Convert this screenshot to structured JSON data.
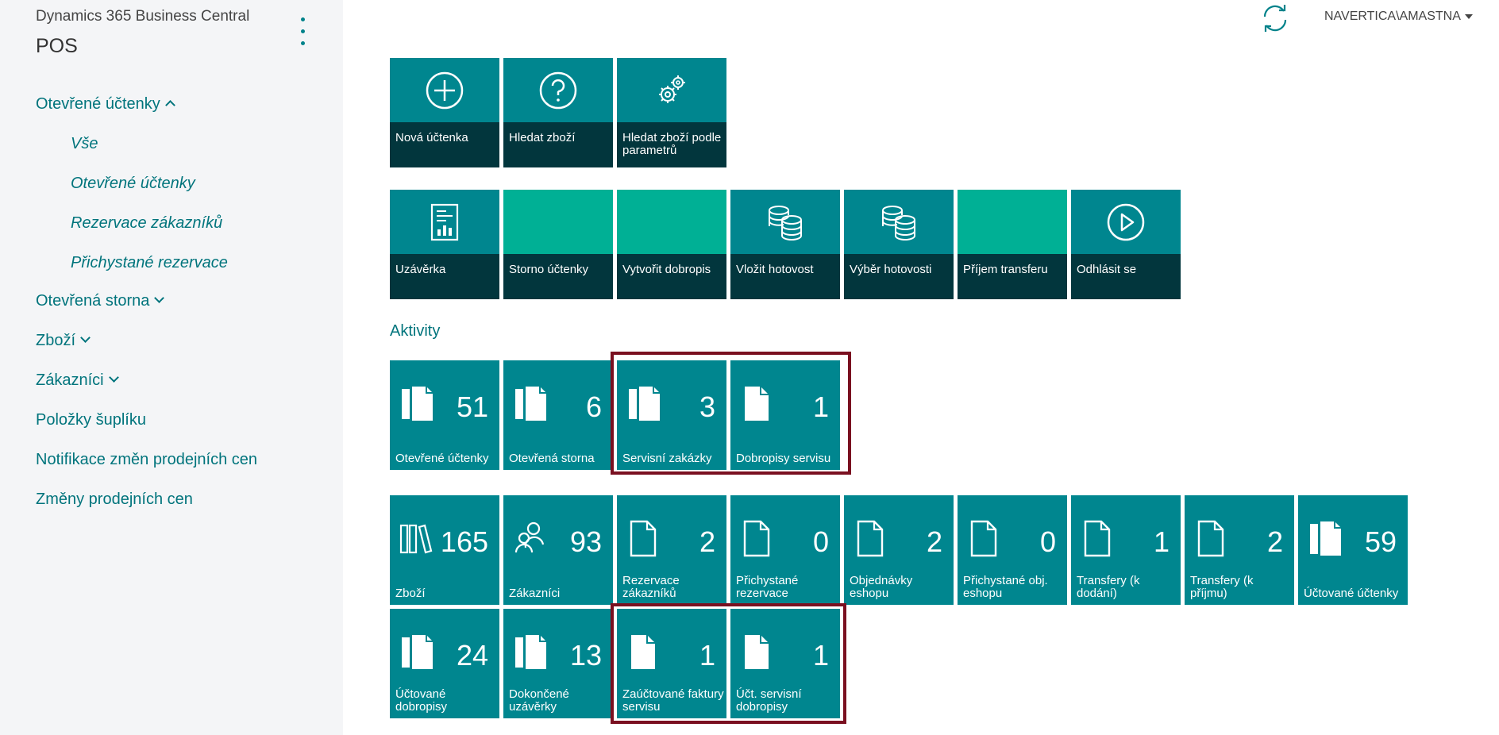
{
  "header": {
    "app_name": "Dynamics 365 Business Central",
    "role_title": "POS",
    "user": "NAVERTICA\\AMASTNA"
  },
  "nav": {
    "open_receipts": "Otevřené účtenky",
    "all": "Vše",
    "open_receipts_sub": "Otevřené účtenky",
    "customer_reservations": "Rezervace zákazníků",
    "prepared_reservations": "Přichystané rezervace",
    "open_reversals": "Otevřená storna",
    "items": "Zboží",
    "customers": "Zákazníci",
    "drawer_entries": "Položky šuplíku",
    "price_notifications": "Notifikace změn prodejních cen",
    "price_changes": "Změny prodejních cen"
  },
  "actions_row1": [
    {
      "label": "Nová účtenka",
      "icon": "plus-circle-icon"
    },
    {
      "label": "Hledat zboží",
      "icon": "question-circle-icon"
    },
    {
      "label": "Hledat zboží podle parametrů",
      "icon": "gears-icon"
    }
  ],
  "actions_row2": [
    {
      "label": "Uzávěrka",
      "icon": "report-icon"
    },
    {
      "label": "Storno účtenky",
      "icon": ""
    },
    {
      "label": "Vytvořit dobropis",
      "icon": ""
    },
    {
      "label": "Vložit hotovost",
      "icon": "coins-icon"
    },
    {
      "label": "Výběr hotovosti",
      "icon": "coins-icon"
    },
    {
      "label": "Příjem transferu",
      "icon": ""
    },
    {
      "label": "Odhlásit se",
      "icon": "play-circle-icon"
    }
  ],
  "activities_title": "Aktivity",
  "cues_row1": [
    {
      "label": "Otevřené účtenky",
      "count": "51",
      "icon": "documents-icon"
    },
    {
      "label": "Otevřená storna",
      "count": "6",
      "icon": "documents-icon"
    },
    {
      "label": "Servisní zakázky",
      "count": "3",
      "icon": "documents-icon"
    },
    {
      "label": "Dobropisy servisu",
      "count": "1",
      "icon": "document-icon"
    }
  ],
  "cues_row2": [
    {
      "label": "Zboží",
      "count": "165",
      "icon": "library-icon"
    },
    {
      "label": "Zákazníci",
      "count": "93",
      "icon": "people-icon"
    },
    {
      "label": "Rezervace zákazníků",
      "count": "2",
      "icon": "document-icon"
    },
    {
      "label": "Přichystané rezervace",
      "count": "0",
      "icon": "document-icon"
    },
    {
      "label": "Objednávky eshopu",
      "count": "2",
      "icon": "document-icon"
    },
    {
      "label": "Přichystané obj. eshopu",
      "count": "0",
      "icon": "document-icon"
    },
    {
      "label": "Transfery (k dodání)",
      "count": "1",
      "icon": "document-icon"
    },
    {
      "label": "Transfery (k příjmu)",
      "count": "2",
      "icon": "document-icon"
    },
    {
      "label": "Účtované účtenky",
      "count": "59",
      "icon": "documents-icon"
    }
  ],
  "cues_row3": [
    {
      "label": "Účtované dobropisy",
      "count": "24",
      "icon": "documents-icon"
    },
    {
      "label": "Dokončené uzávěrky",
      "count": "13",
      "icon": "documents-icon"
    },
    {
      "label": "Zaúčtované faktury servisu",
      "count": "1",
      "icon": "document-icon"
    },
    {
      "label": "Účt. servisní dobropisy",
      "count": "1",
      "icon": "document-icon"
    }
  ],
  "colors": {
    "tile": "#00868f",
    "tile_dark": "#02363d",
    "tile_blank": "#00b095",
    "accent_text": "#00747c",
    "highlight": "#7a1020"
  }
}
